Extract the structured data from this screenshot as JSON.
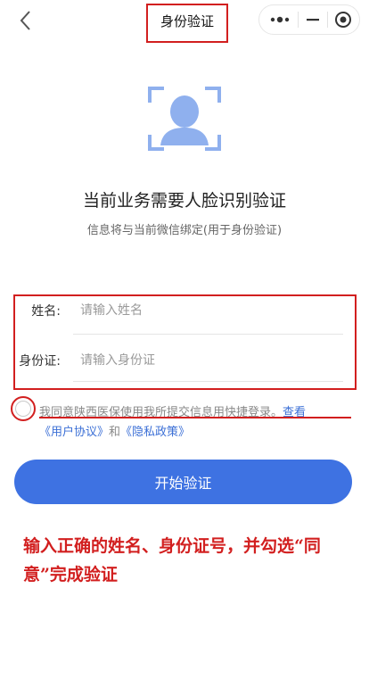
{
  "header": {
    "back_icon": "chevron-left-icon",
    "title": "身份验证",
    "capsule_more_icon": "more-dots-icon",
    "capsule_minimize_icon": "minimize-icon",
    "capsule_record_icon": "record-circle-icon"
  },
  "hero": {
    "icon": "face-scan-icon",
    "headline": "当前业务需要人脸识别验证",
    "subline": "信息将与当前微信绑定(用于身份验证)"
  },
  "form": {
    "name_label": "姓名:",
    "name_placeholder": "请输入姓名",
    "id_label": "身份证:",
    "id_placeholder": "请输入身份证"
  },
  "agreement": {
    "text_part": "我同意陕西医保使用我所提交信息用快捷登录。",
    "view": "查看",
    "user_agreement": "《用户协议》",
    "and": "和",
    "privacy_policy": "《隐私政策》"
  },
  "button": {
    "start": "开始验证"
  },
  "annotation": {
    "text": "输入正确的姓名、身份证号，并勾选“同意”完成验证"
  },
  "colors": {
    "accent": "#3e72e2",
    "annotation_red": "#d21f1f",
    "link": "#3b6fd6"
  }
}
